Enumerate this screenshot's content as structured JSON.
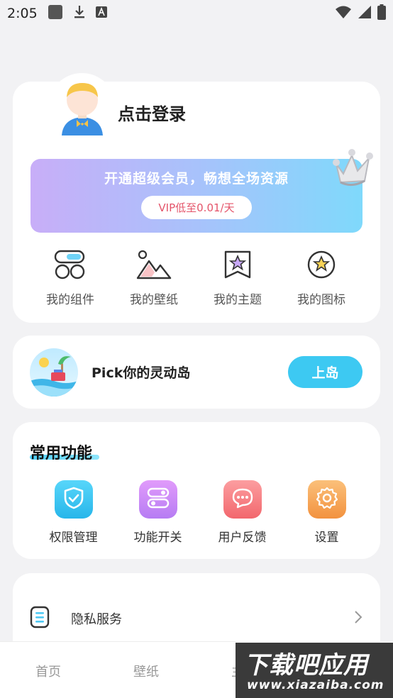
{
  "status_bar": {
    "time": "2:05"
  },
  "profile": {
    "login_text": "点击登录",
    "vip_title": "开通超级会员，畅想全场资源",
    "vip_button": "VIP低至0.01/天"
  },
  "my_items": [
    {
      "label": "我的组件",
      "icon": "widget-icon"
    },
    {
      "label": "我的壁纸",
      "icon": "wallpaper-icon"
    },
    {
      "label": "我的主题",
      "icon": "theme-icon"
    },
    {
      "label": "我的图标",
      "icon": "star-icon"
    }
  ],
  "island": {
    "text": "Pick你的灵动岛",
    "button": "上岛"
  },
  "common": {
    "title": "常用功能",
    "items": [
      {
        "label": "权限管理",
        "icon": "shield-icon",
        "color": "#3ec8f2"
      },
      {
        "label": "功能开关",
        "icon": "toggle-icon",
        "color": "#c489f5"
      },
      {
        "label": "用户反馈",
        "icon": "chat-icon",
        "color": "#f5787c"
      },
      {
        "label": "设置",
        "icon": "gear-icon",
        "color": "#f7a55c"
      }
    ]
  },
  "privacy": {
    "label": "隐私服务"
  },
  "bottom_nav": [
    {
      "label": "首页"
    },
    {
      "label": "壁纸"
    },
    {
      "label": "主"
    }
  ],
  "watermark": {
    "title": "下载吧应用",
    "url": "www.xiazaiba.com"
  }
}
